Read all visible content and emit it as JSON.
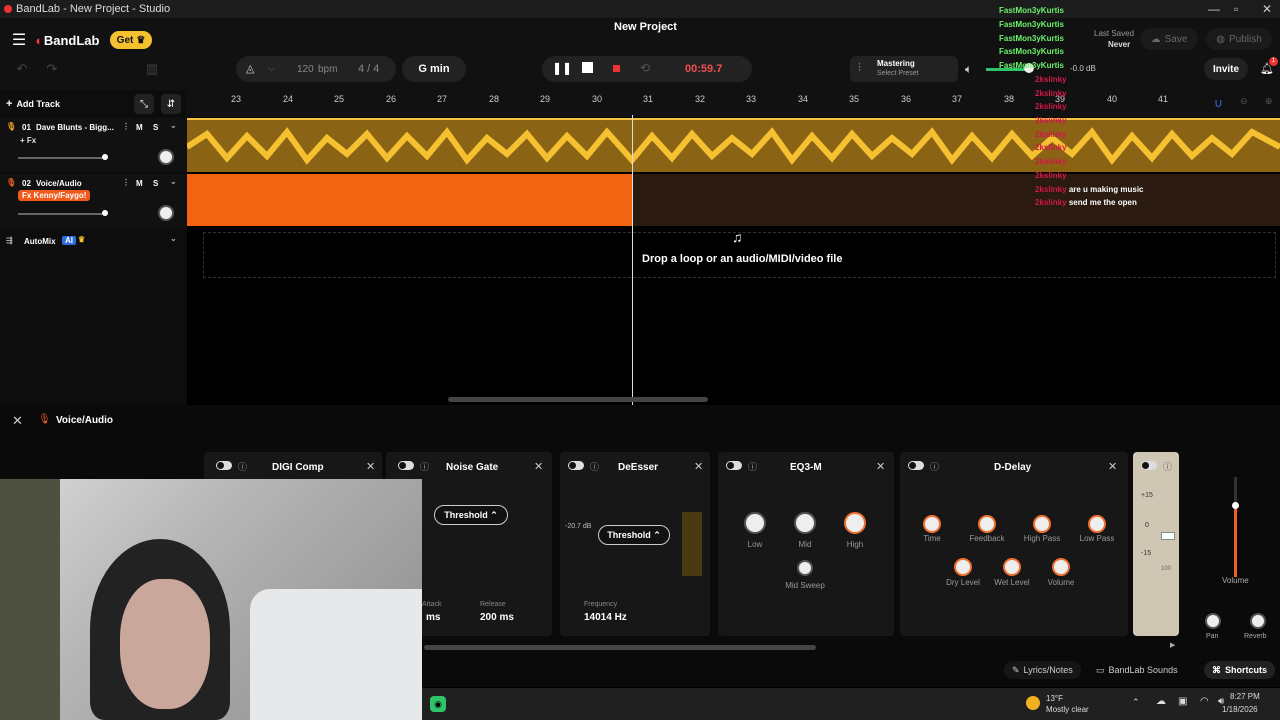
{
  "titlebar": {
    "title": "BandLab - New Project - Studio"
  },
  "header": {
    "logo": "BandLab",
    "get_label": "Get",
    "project_title": "New Project",
    "bpm_value": "120",
    "bpm_unit": "bpm",
    "time_sig": "4 / 4",
    "key": "G min",
    "time": "00:59.7",
    "mastering_title": "Mastering",
    "mastering_preset": "Select Preset",
    "volume_db": "-0.0 dB",
    "last_saved_label": "Last Saved",
    "last_saved_value": "Never",
    "save_label": "Save",
    "publish_label": "Publish",
    "invite_label": "Invite",
    "notif_count": "1"
  },
  "sidebar": {
    "add_track": "Add Track",
    "tracks": [
      {
        "num": "01",
        "name": "Dave Blunts - Bigg...",
        "fx": "+ Fx",
        "m": "M",
        "s": "S"
      },
      {
        "num": "02",
        "name": "Voice/Audio",
        "fx": "Fx Kenny/Faygo!",
        "m": "M",
        "s": "S"
      }
    ],
    "automix": "AutoMix",
    "automix_badge": "AI"
  },
  "ruler": [
    "23",
    "24",
    "25",
    "26",
    "27",
    "28",
    "29",
    "30",
    "31",
    "32",
    "33",
    "34",
    "35",
    "36",
    "37",
    "38",
    "39",
    "40",
    "41"
  ],
  "drop_text": "Drop a loop or an audio/MIDI/video file",
  "fx": {
    "track_name": "Voice/Audio",
    "devices": [
      {
        "name": "DIGI Comp"
      },
      {
        "name": "Noise Gate",
        "threshold": "Threshold",
        "attack_label": "Attack",
        "attack_value": "ms",
        "release_label": "Release",
        "release_value": "200 ms"
      },
      {
        "name": "DeEsser",
        "threshold": "Threshold",
        "db": "-20.7 dB",
        "freq_label": "Frequency",
        "freq_value": "14014 Hz"
      },
      {
        "name": "EQ3-M",
        "knobs": [
          "Low",
          "Mid",
          "High",
          "Mid Sweep"
        ]
      },
      {
        "name": "D-Delay",
        "knobs": [
          "Time",
          "Feedback",
          "High Pass",
          "Low Pass",
          "Dry Level",
          "Wet Level",
          "Volume"
        ]
      }
    ],
    "fader_scale": [
      "+15",
      "0",
      "-15",
      "100"
    ],
    "volume_label": "Volume",
    "pan_label": "Pan",
    "reverb_label": "Reverb",
    "bottom": {
      "lyrics": "Lyrics/Notes",
      "sounds": "BandLab Sounds",
      "shortcuts": "Shortcuts"
    }
  },
  "taskbar": {
    "temp": "13°F",
    "weather": "Mostly clear",
    "time": "8:27 PM",
    "date": "1/18/2026"
  },
  "chat": [
    {
      "user": "FastMon3yKurtis",
      "msg": "",
      "color": "green"
    },
    {
      "user": "FastMon3yKurtis",
      "msg": "",
      "color": "green"
    },
    {
      "user": "FastMon3yKurtis",
      "msg": "",
      "color": "green"
    },
    {
      "user": "FastMon3yKurtis",
      "msg": "",
      "color": "green"
    },
    {
      "user": "FastMon3yKurtis",
      "msg": "",
      "color": "green"
    },
    {
      "user": "2kslinky",
      "msg": "",
      "color": "red"
    },
    {
      "user": "2kslinky",
      "msg": "",
      "color": "red"
    },
    {
      "user": "2kslinky",
      "msg": "",
      "color": "red"
    },
    {
      "user": "2kslinky",
      "msg": "",
      "color": "red"
    },
    {
      "user": "2kslinky",
      "msg": "",
      "color": "red"
    },
    {
      "user": "2kslinky",
      "msg": "",
      "color": "red"
    },
    {
      "user": "2kslinky",
      "msg": "",
      "color": "red"
    },
    {
      "user": "2kslinky",
      "msg": "",
      "color": "red"
    },
    {
      "user": "2kslinky",
      "msg": "are u making music",
      "color": "red"
    },
    {
      "user": "2kslinky",
      "msg": "send me the open",
      "color": "red"
    }
  ]
}
